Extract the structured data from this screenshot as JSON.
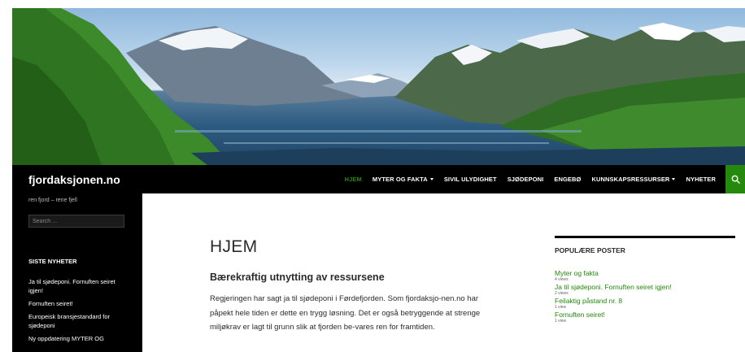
{
  "site": {
    "title": "fjordaksjonen.no",
    "tagline": "ren fjord – rene fjell"
  },
  "nav": {
    "items": [
      {
        "label": "HJEM",
        "active": true,
        "has_dropdown": false
      },
      {
        "label": "MYTER OG FAKTA",
        "active": false,
        "has_dropdown": true
      },
      {
        "label": "SIVIL ULYDIGHET",
        "active": false,
        "has_dropdown": false
      },
      {
        "label": "SJØDEPONI",
        "active": false,
        "has_dropdown": false
      },
      {
        "label": "ENGEBØ",
        "active": false,
        "has_dropdown": false
      },
      {
        "label": "KUNNSKAPSRESSURSER",
        "active": false,
        "has_dropdown": true
      },
      {
        "label": "NYHETER",
        "active": false,
        "has_dropdown": false
      }
    ],
    "search_icon": "search-icon"
  },
  "sidebar": {
    "search_placeholder": "Search …",
    "widget_title": "SISTE NYHETER",
    "items": [
      "Ja til sjødeponi. Fornuften seiret igjen!",
      "Fornuften seiret!",
      "Europeisk bransjestandard for sjødeponi",
      "Ny oppdatering MYTER OG"
    ]
  },
  "main": {
    "page_title": "HJEM",
    "article_heading": "Bærekraftig utnytting av ressursene",
    "article_body": "Regjeringen har sagt ja til sjødeponi i Førdefjorden. Som fjordaksjo-nen.no har påpekt hele tiden er dette en trygg løsning. Det er også betryggende at strenge miljøkrav er lagt til grunn slik at fjorden be-vares ren for framtiden."
  },
  "popular": {
    "title": "POPULÆRE POSTER",
    "posts": [
      {
        "title": "Myter og fakta",
        "views": "4 views"
      },
      {
        "title": "Ja til sjødeponi. Fornuften seiret igjen!",
        "views": "2 views"
      },
      {
        "title": "Feilaktig påstand nr. 8",
        "views": "1 view"
      },
      {
        "title": "Fornuften seiret!",
        "views": "1 view"
      }
    ]
  },
  "colors": {
    "accent": "#24890d",
    "header_bg": "#000000",
    "text": "#2b2b2b"
  }
}
